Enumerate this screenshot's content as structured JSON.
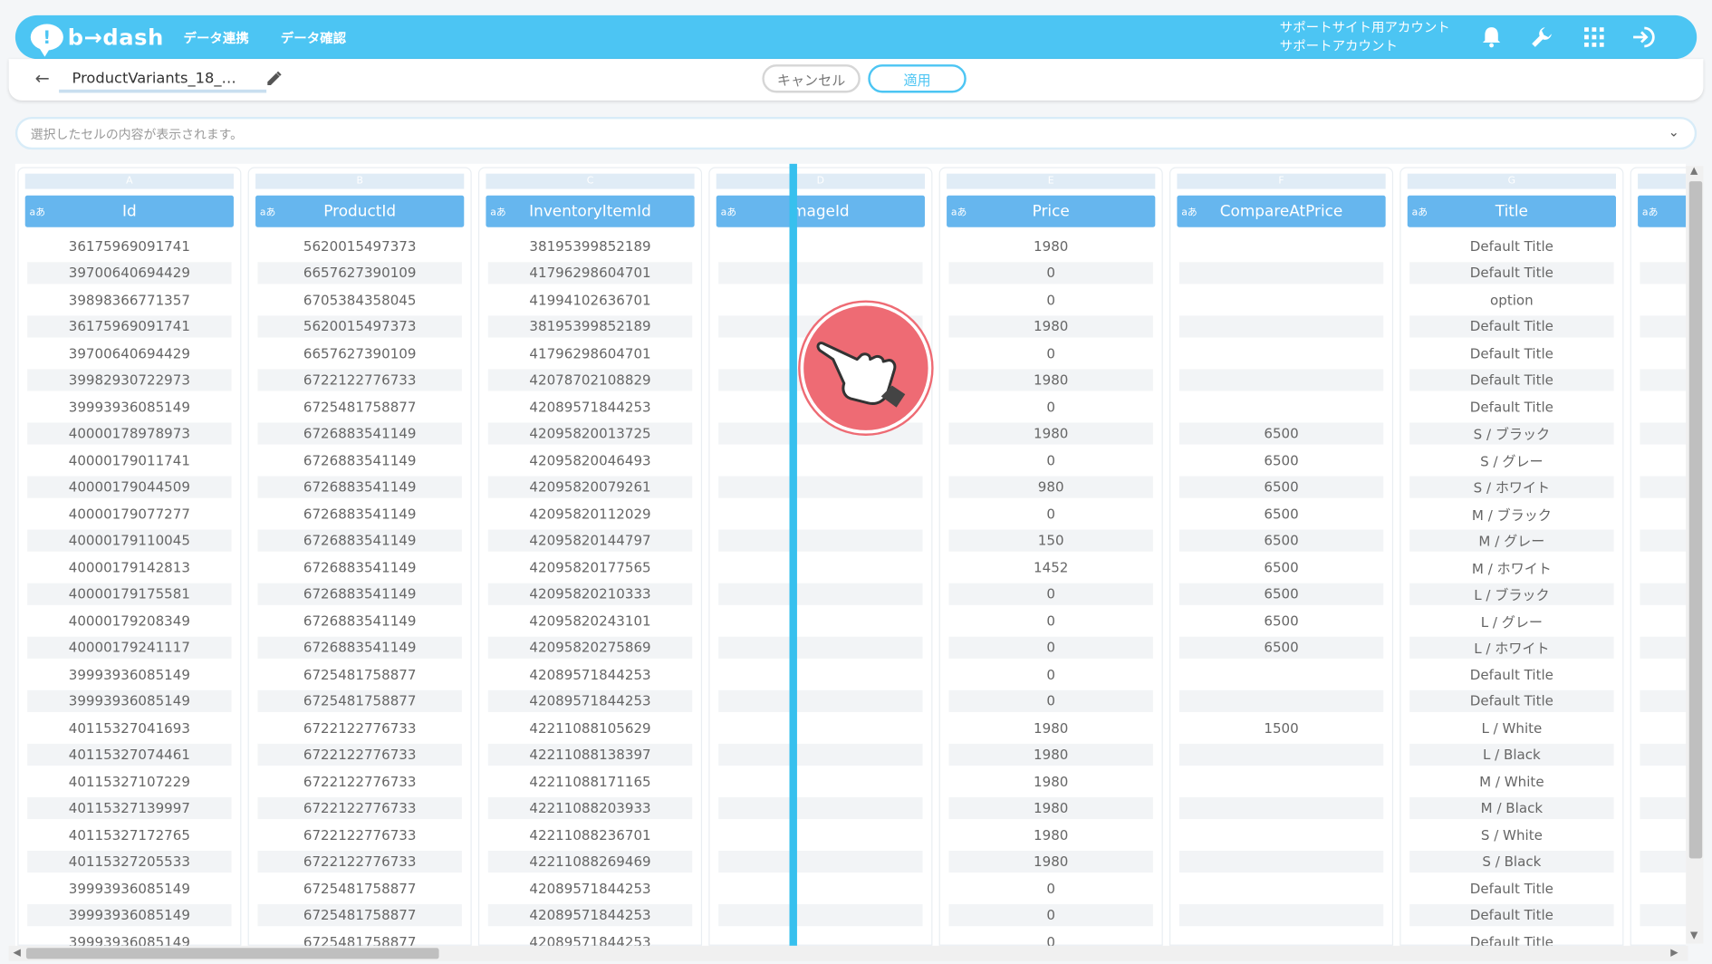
{
  "header": {
    "logo_text": "b→dash",
    "nav": [
      "データ連携",
      "データ確認"
    ],
    "account_line1": "サポートサイト用アカウント",
    "account_line2": "サポートアカウント",
    "icons": [
      "bell-icon",
      "wrench-icon",
      "apps-grid-icon",
      "logout-icon"
    ],
    "accent_color": "#4cc5f3"
  },
  "toolbar": {
    "back_icon": "←",
    "file_name": "ProductVariants_18_…",
    "cancel_label": "キャンセル",
    "apply_label": "適用"
  },
  "cell_bar": {
    "placeholder": "選択したセルの内容が表示されます。",
    "chevron": "⌄"
  },
  "grid": {
    "type_badge": "aあ",
    "columns": [
      {
        "letter": "A",
        "name": "Id"
      },
      {
        "letter": "B",
        "name": "ProductId"
      },
      {
        "letter": "C",
        "name": "InventoryItemId"
      },
      {
        "letter": "D",
        "name": "mageId"
      },
      {
        "letter": "E",
        "name": "Price"
      },
      {
        "letter": "F",
        "name": "CompareAtPrice"
      },
      {
        "letter": "G",
        "name": "Title"
      }
    ],
    "rows": [
      [
        "36175969091741",
        "5620015497373",
        "38195399852189",
        "",
        "1980",
        "",
        "Default Title"
      ],
      [
        "39700640694429",
        "6657627390109",
        "41796298604701",
        "",
        "0",
        "",
        "Default Title"
      ],
      [
        "39898366771357",
        "6705384358045",
        "41994102636701",
        "",
        "0",
        "",
        "option"
      ],
      [
        "36175969091741",
        "5620015497373",
        "38195399852189",
        "",
        "1980",
        "",
        "Default Title"
      ],
      [
        "39700640694429",
        "6657627390109",
        "41796298604701",
        "",
        "0",
        "",
        "Default Title"
      ],
      [
        "39982930722973",
        "6722122776733",
        "42078702108829",
        "",
        "1980",
        "",
        "Default Title"
      ],
      [
        "39993936085149",
        "6725481758877",
        "42089571844253",
        "",
        "0",
        "",
        "Default Title"
      ],
      [
        "40000178978973",
        "6726883541149",
        "42095820013725",
        "",
        "1980",
        "6500",
        "S / ブラック"
      ],
      [
        "40000179011741",
        "6726883541149",
        "42095820046493",
        "",
        "0",
        "6500",
        "S / グレー"
      ],
      [
        "40000179044509",
        "6726883541149",
        "42095820079261",
        "",
        "980",
        "6500",
        "S / ホワイト"
      ],
      [
        "40000179077277",
        "6726883541149",
        "42095820112029",
        "",
        "0",
        "6500",
        "M / ブラック"
      ],
      [
        "40000179110045",
        "6726883541149",
        "42095820144797",
        "",
        "150",
        "6500",
        "M / グレー"
      ],
      [
        "40000179142813",
        "6726883541149",
        "42095820177565",
        "",
        "1452",
        "6500",
        "M / ホワイト"
      ],
      [
        "40000179175581",
        "6726883541149",
        "42095820210333",
        "",
        "0",
        "6500",
        "L / ブラック"
      ],
      [
        "40000179208349",
        "6726883541149",
        "42095820243101",
        "",
        "0",
        "6500",
        "L / グレー"
      ],
      [
        "40000179241117",
        "6726883541149",
        "42095820275869",
        "",
        "0",
        "6500",
        "L / ホワイト"
      ],
      [
        "39993936085149",
        "6725481758877",
        "42089571844253",
        "",
        "0",
        "",
        "Default Title"
      ],
      [
        "39993936085149",
        "6725481758877",
        "42089571844253",
        "",
        "0",
        "",
        "Default Title"
      ],
      [
        "40115327041693",
        "6722122776733",
        "42211088105629",
        "",
        "1980",
        "1500",
        "L / White"
      ],
      [
        "40115327074461",
        "6722122776733",
        "42211088138397",
        "",
        "1980",
        "",
        "L / Black"
      ],
      [
        "40115327107229",
        "6722122776733",
        "42211088171165",
        "",
        "1980",
        "",
        "M / White"
      ],
      [
        "40115327139997",
        "6722122776733",
        "42211088203933",
        "",
        "1980",
        "",
        "M / Black"
      ],
      [
        "40115327172765",
        "6722122776733",
        "42211088236701",
        "",
        "1980",
        "",
        "S / White"
      ],
      [
        "40115327205533",
        "6722122776733",
        "42211088269469",
        "",
        "1980",
        "",
        "S / Black"
      ],
      [
        "39993936085149",
        "6725481758877",
        "42089571844253",
        "",
        "0",
        "",
        "Default Title"
      ],
      [
        "39993936085149",
        "6725481758877",
        "42089571844253",
        "",
        "0",
        "",
        "Default Title"
      ],
      [
        "39993936085149",
        "6725481758877",
        "42089571844253",
        "",
        "0",
        "",
        "Default Title"
      ]
    ]
  }
}
